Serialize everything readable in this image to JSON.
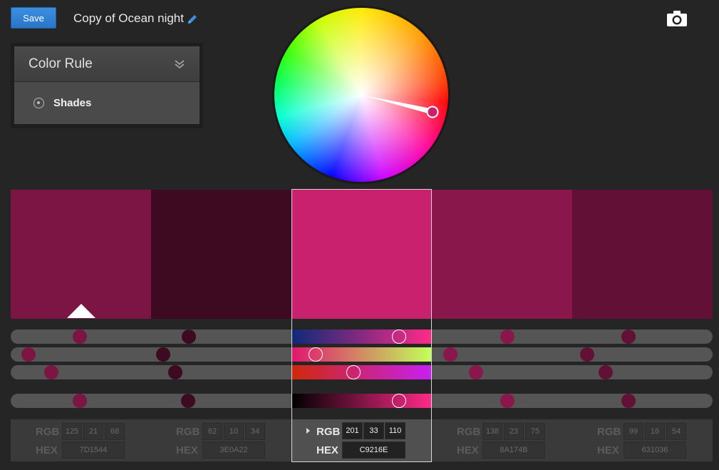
{
  "header": {
    "save_label": "Save",
    "theme_name": "Copy of Ocean night"
  },
  "icons": {
    "edit": "pencil-icon",
    "camera": "camera-icon",
    "collapse": "double-chevron-down-icon",
    "radio": "radio-icon"
  },
  "rule_panel": {
    "title": "Color Rule",
    "value": "Shades"
  },
  "colors": {
    "accent": "#2a75c8",
    "background": "#252525"
  },
  "swatches": [
    {
      "hex": "7D1544",
      "r": "125",
      "g": "21",
      "b": "68",
      "color": "#7D1544"
    },
    {
      "hex": "3E0A22",
      "r": "62",
      "g": "10",
      "b": "34",
      "color": "#3E0A22"
    },
    {
      "hex": "C9216E",
      "r": "201",
      "g": "33",
      "b": "110",
      "color": "#C9216E",
      "active": true
    },
    {
      "hex": "8A174B",
      "r": "138",
      "g": "23",
      "b": "75",
      "color": "#8A174B"
    },
    {
      "hex": "631036",
      "r": "99",
      "g": "16",
      "b": "54",
      "color": "#631036"
    }
  ],
  "value_labels": {
    "rgb": "RGB",
    "hex": "HEX"
  }
}
